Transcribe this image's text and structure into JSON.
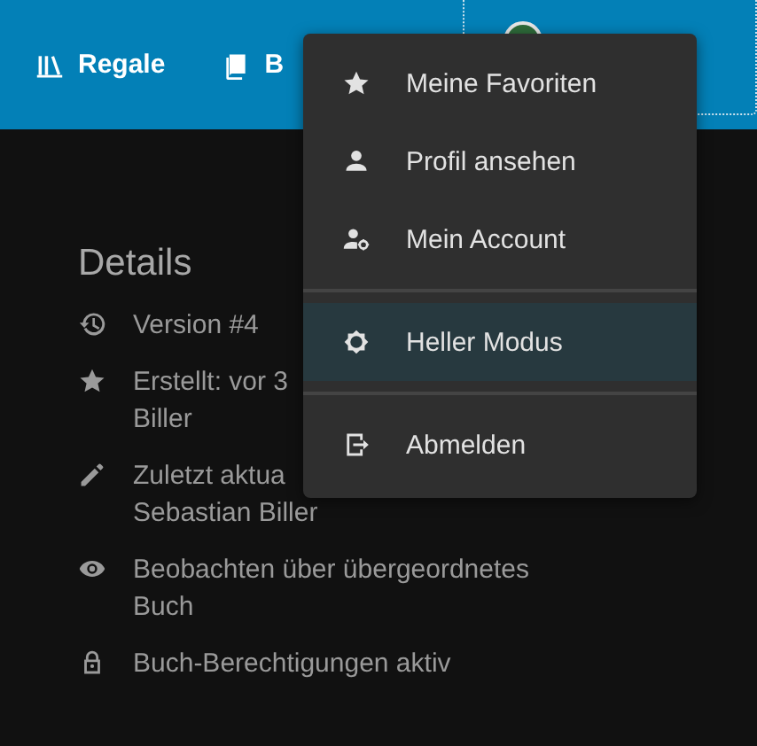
{
  "header": {
    "nav": [
      {
        "kind": "shelves",
        "label": "Regale"
      },
      {
        "kind": "books",
        "label": "B"
      }
    ]
  },
  "details": {
    "title": "Details",
    "items": [
      {
        "kind": "version",
        "lines": [
          "Version #4"
        ]
      },
      {
        "kind": "created",
        "lines": [
          "Erstellt: vor 3",
          "Biller"
        ]
      },
      {
        "kind": "updated",
        "lines": [
          "Zuletzt aktua",
          "Sebastian Biller"
        ]
      },
      {
        "kind": "watch",
        "lines": [
          "Beobachten über übergeordnetes",
          "Buch"
        ]
      },
      {
        "kind": "lock",
        "lines": [
          "Buch-Berechtigungen aktiv"
        ]
      }
    ]
  },
  "user_menu": {
    "groups": [
      [
        {
          "kind": "star",
          "label": "Meine Favoriten",
          "selected": false
        },
        {
          "kind": "user",
          "label": "Profil ansehen",
          "selected": false
        },
        {
          "kind": "account",
          "label": "Mein Account",
          "selected": false
        }
      ],
      [
        {
          "kind": "theme",
          "label": "Heller Modus",
          "selected": true
        }
      ],
      [
        {
          "kind": "logout",
          "label": "Abmelden",
          "selected": false
        }
      ]
    ]
  }
}
